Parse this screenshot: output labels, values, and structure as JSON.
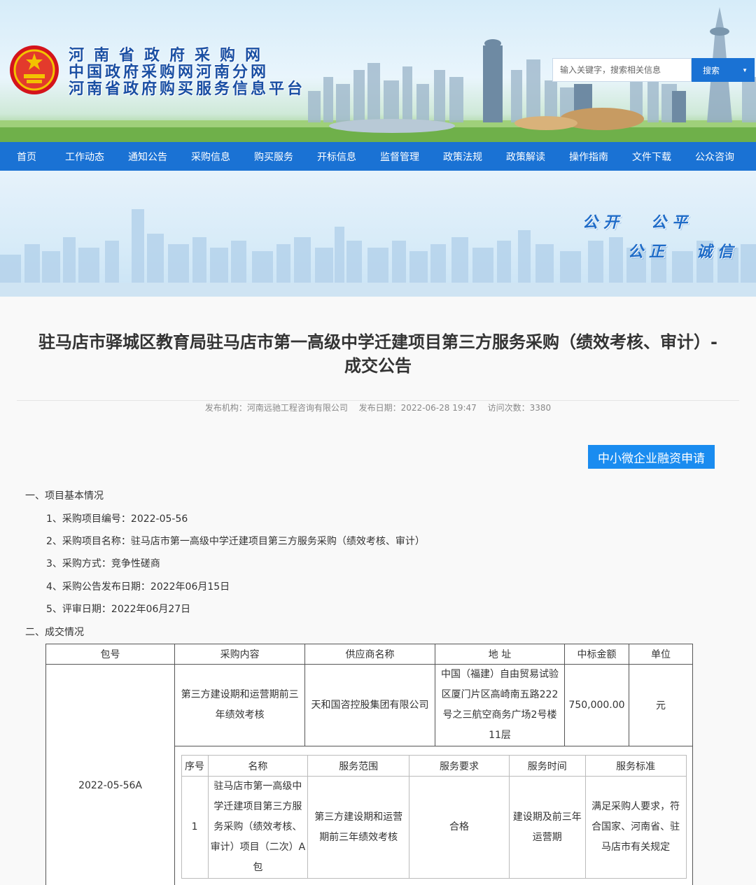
{
  "header": {
    "site_names": [
      "河南省政府采购网",
      "中国政府采购网河南分网",
      "河南省政府购买服务信息平台"
    ],
    "search": {
      "placeholder": "输入关键字，搜索相关信息",
      "button_label": "搜索"
    }
  },
  "nav": {
    "items": [
      "首页",
      "工作动态",
      "通知公告",
      "采购信息",
      "购买服务",
      "开标信息",
      "监督管理",
      "政策法规",
      "政策解读",
      "操作指南",
      "文件下载",
      "公众咨询"
    ]
  },
  "banner": {
    "words": [
      "公开",
      "公平",
      "公正",
      "诚信"
    ]
  },
  "article": {
    "title_line1": "驻马店市驿城区教育局驻马店市第一高级中学迁建项目第三方服务采购（绩效考核、审计）-",
    "title_line2": "成交公告",
    "meta": {
      "publisher": "发布机构：河南远驰工程咨询有限公司",
      "date": "发布日期：2022-06-28 19:47",
      "visits": "访问次数：3380"
    },
    "finance_button": "中小微企业融资申请",
    "section1_heading": "一、项目基本情况",
    "section1_items": [
      "1、采购项目编号：2022-05-56",
      "2、采购项目名称：驻马店市第一高级中学迁建项目第三方服务采购（绩效考核、审计）",
      "3、采购方式：竞争性磋商",
      "4、采购公告发布日期：2022年06月15日",
      "5、评审日期：2022年06月27日"
    ],
    "section2_heading": "二、成交情况"
  },
  "deal_table": {
    "headers": [
      "包号",
      "采购内容",
      "供应商名称",
      "地 址",
      "中标金额",
      "单位"
    ],
    "package_no": "2022-05-56A",
    "content": "第三方建设期和运营期前三年绩效考核",
    "supplier": "天和国咨控股集团有限公司",
    "address": "中国（福建）自由贸易试验区厦门片区高崎南五路222号之三航空商务广场2号楼11层",
    "amount": "750,000.00",
    "unit": "元",
    "sub_headers": [
      "序号",
      "名称",
      "服务范围",
      "服务要求",
      "服务时间",
      "服务标准"
    ],
    "sub_row": {
      "no": "1",
      "name": "驻马店市第一高级中学迁建项目第三方服务采购（绩效考核、审计）项目（二次）A包",
      "scope": "第三方建设期和运营期前三年绩效考核",
      "requirement": "合格",
      "time": "建设期及前三年运营期",
      "standard": "满足采购人要求，符合国家、河南省、驻马店市有关规定"
    }
  },
  "colors": {
    "nav_blue": "#1a72d4",
    "header_text_blue": "#1a4fa3",
    "finance_button_blue": "#1a8cf0"
  }
}
